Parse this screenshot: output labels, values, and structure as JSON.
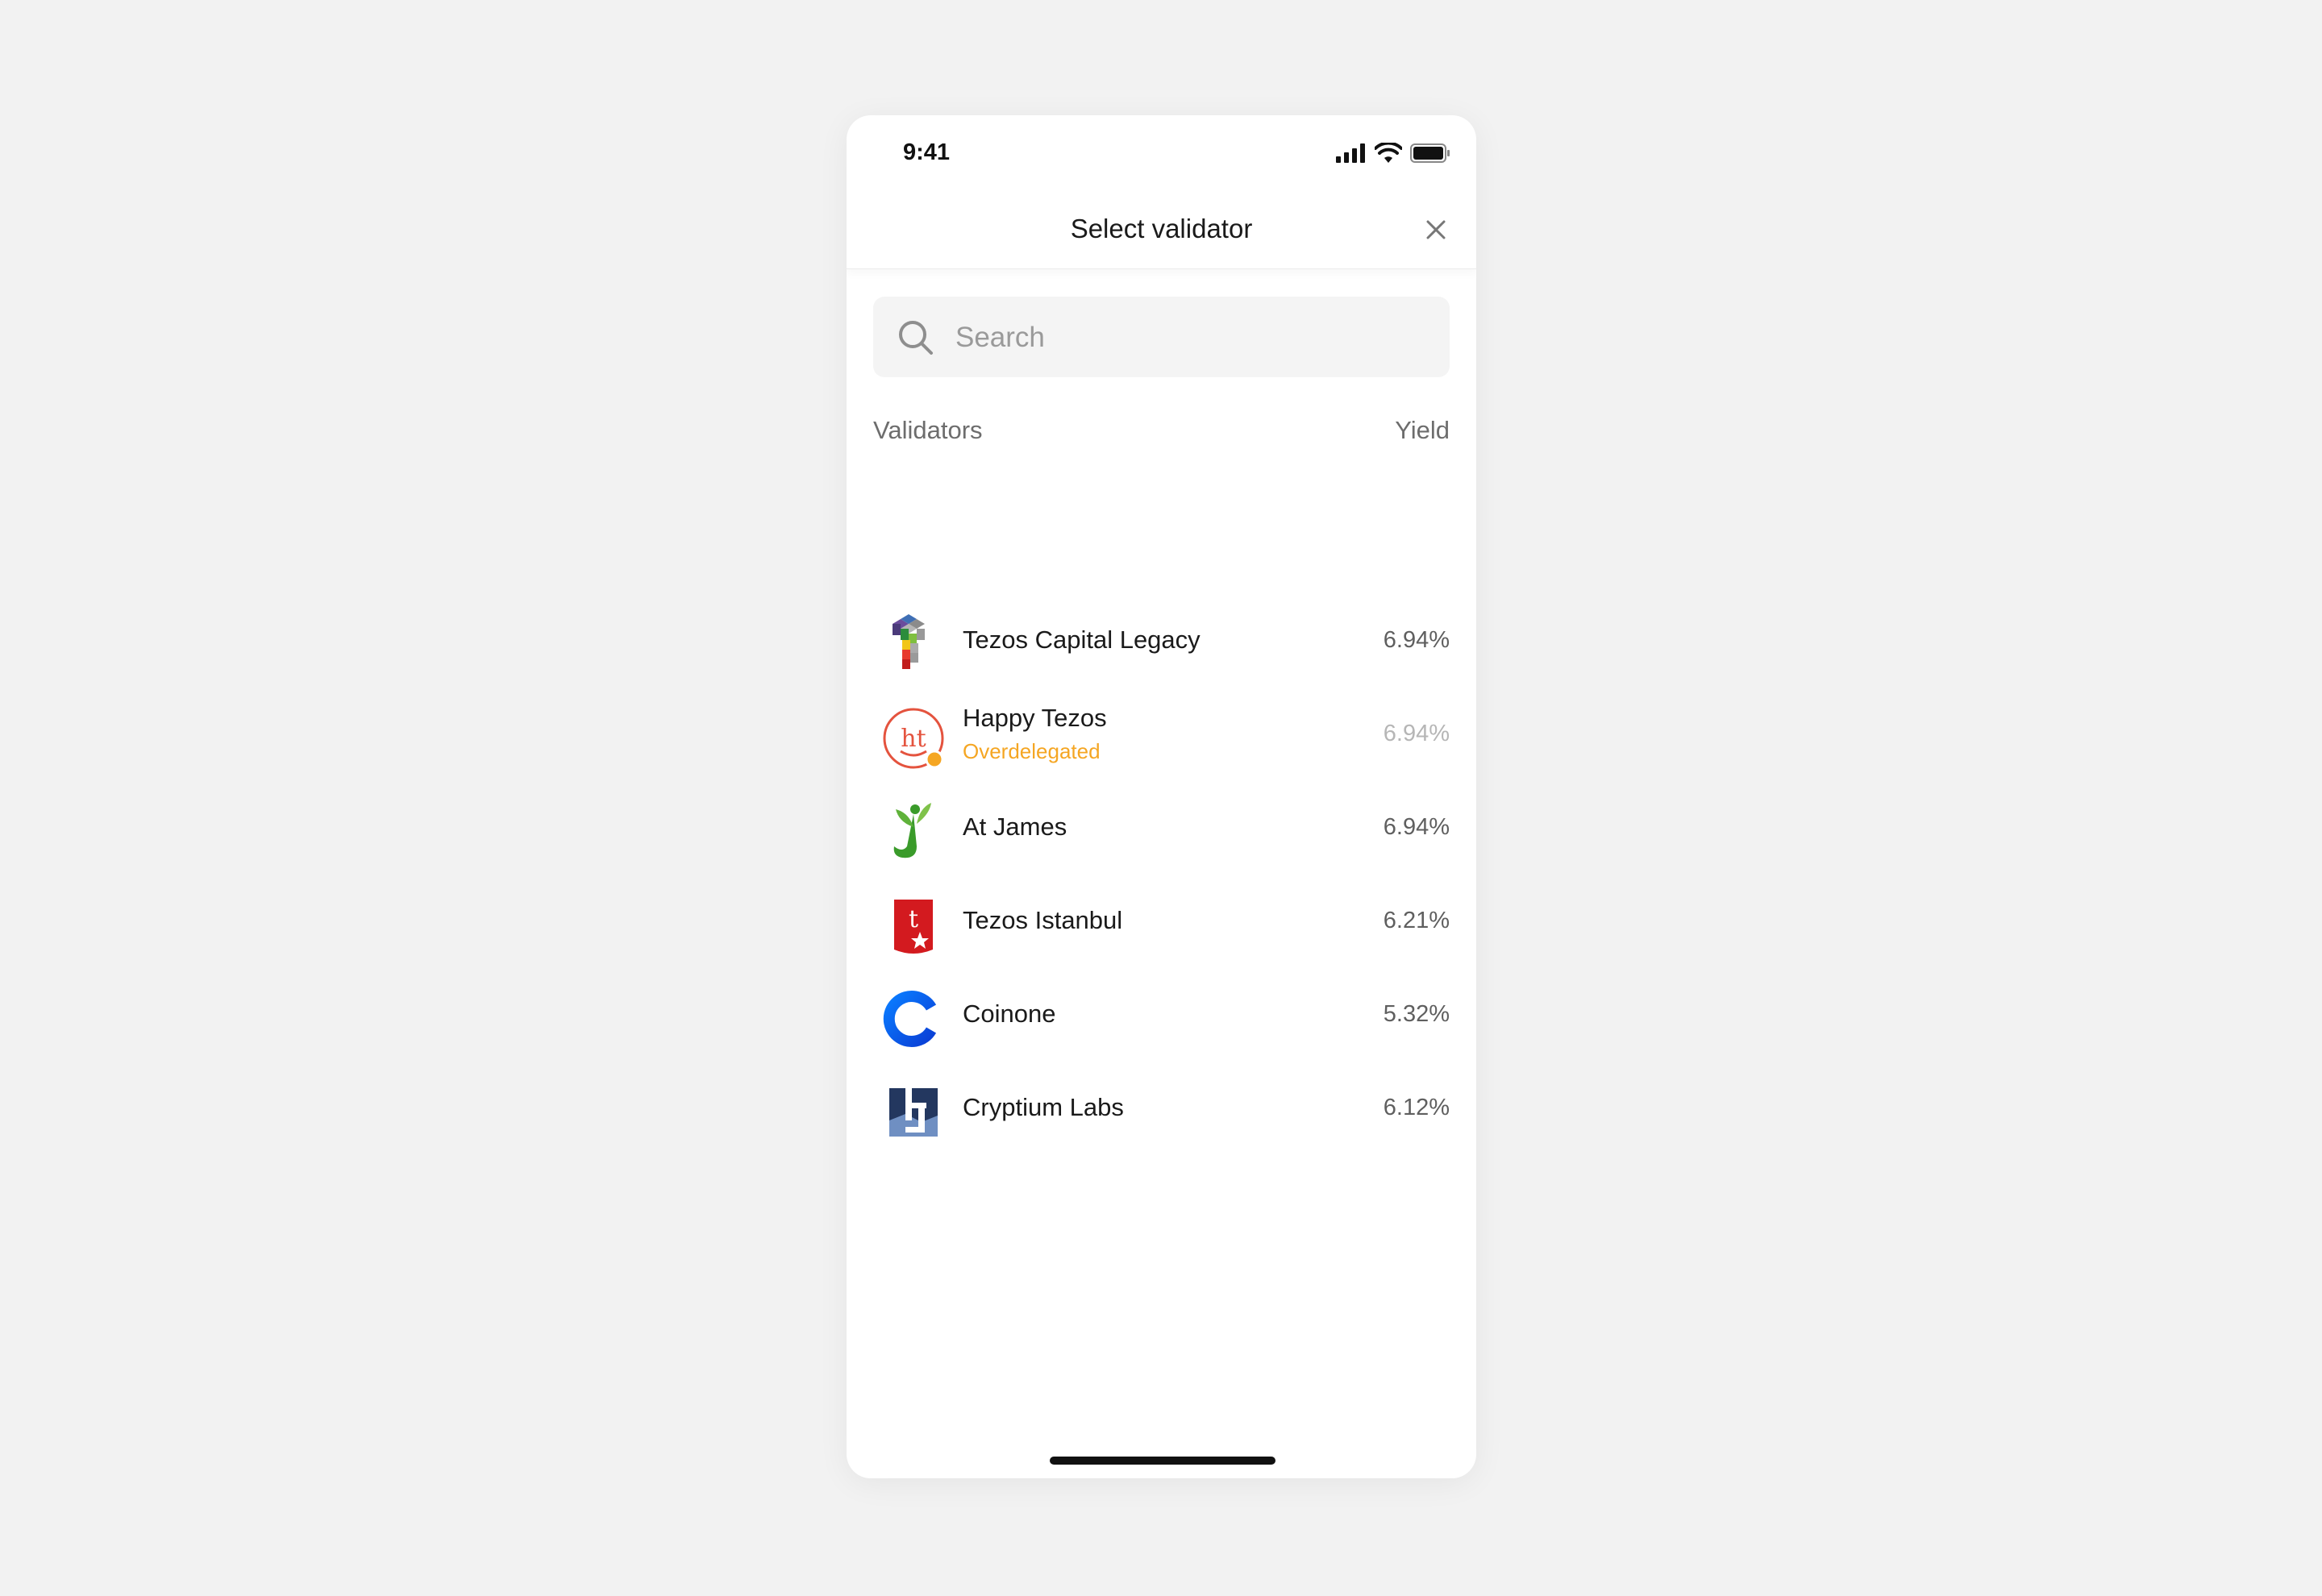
{
  "status_bar": {
    "time": "9:41"
  },
  "header": {
    "title": "Select validator"
  },
  "search": {
    "placeholder": "Search",
    "value": ""
  },
  "list_header": {
    "validators_label": "Validators",
    "yield_label": "Yield"
  },
  "validators": [
    {
      "name": "Tezos Capital Legacy",
      "yield": "6.94%",
      "status": "",
      "logo": "tezos-capital-logo-icon"
    },
    {
      "name": "Happy Tezos",
      "yield": "6.94%",
      "status": "Overdelegated",
      "logo": "happy-tezos-logo-icon"
    },
    {
      "name": "At James",
      "yield": "6.94%",
      "status": "",
      "logo": "at-james-logo-icon"
    },
    {
      "name": "Tezos Istanbul",
      "yield": "6.21%",
      "status": "",
      "logo": "tezos-istanbul-logo-icon"
    },
    {
      "name": "Coinone",
      "yield": "5.32%",
      "status": "",
      "logo": "coinone-logo-icon"
    },
    {
      "name": "Cryptium Labs",
      "yield": "6.12%",
      "status": "",
      "logo": "cryptium-labs-logo-icon"
    }
  ],
  "colors": {
    "warning": "#f5a623",
    "background": "#f2f2f2",
    "text": "#1a1a1a"
  }
}
